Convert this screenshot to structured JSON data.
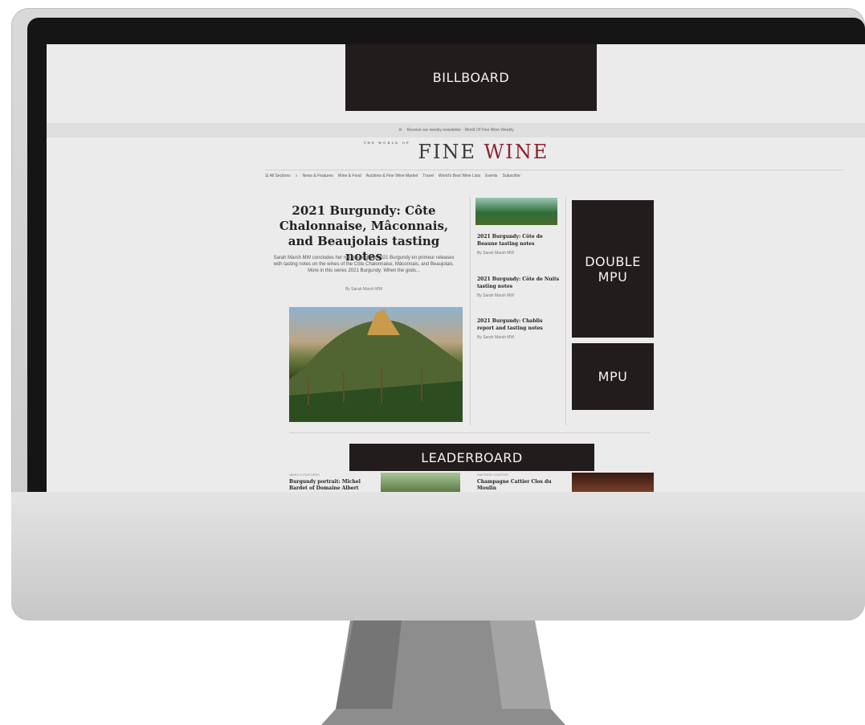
{
  "ads": {
    "billboard": "BILLBOARD",
    "double_mpu": "DOUBLE MPU",
    "mpu": "MPU",
    "leaderboard": "LEADERBOARD"
  },
  "site": {
    "newsletter": "Receive our weekly newsletter · World Of Fine Wine Weekly",
    "logo_main": "FINE",
    "logo_accent": "WINE",
    "logo_small": "THE WORLD OF"
  },
  "nav": {
    "all_sections": "☰ All Sections",
    "search_icon": "magnifier",
    "items": [
      "News & Features",
      "Wine & Food",
      "Auctions & Fine Wine Market",
      "Travel",
      "World's Best Wine Lists",
      "Events",
      "Subscribe"
    ]
  },
  "hero": {
    "title": "2021 Burgundy: Côte Chalonnaise, Mâconnais, and Beaujolais tasting notes",
    "description": "Sarah Marsh MW concludes her round-up of the 2021 Burgundy en primeur releases with tasting notes on the wines of the Côte Chalonnaise, Mâconnais, and Beaujolais. More in this series 2021 Burgundy: When the gods...",
    "byline": "By Sarah Marsh MW"
  },
  "side_stories": [
    {
      "title": "2021 Burgundy: Côte de Beaune tasting notes",
      "byline": "By Sarah Marsh MW"
    },
    {
      "title": "2021 Burgundy: Côte de Nuits tasting notes",
      "byline": "By Sarah Marsh MW"
    },
    {
      "title": "2021 Burgundy: Chablis report and tasting notes",
      "byline": "By Sarah Marsh MW"
    }
  ],
  "cards": [
    {
      "tag": "NEWS & FEATURES",
      "title": "Burgundy portrait: Michel Bardet of Domaine Albert"
    },
    {
      "tag": "PARTNER CONTENT",
      "title": "Champagne Cattier Clos du Moulin"
    }
  ],
  "colors": {
    "ad_bg": "#221d1c",
    "accent": "#8a2432",
    "screen_bg": "#ebebeb"
  }
}
